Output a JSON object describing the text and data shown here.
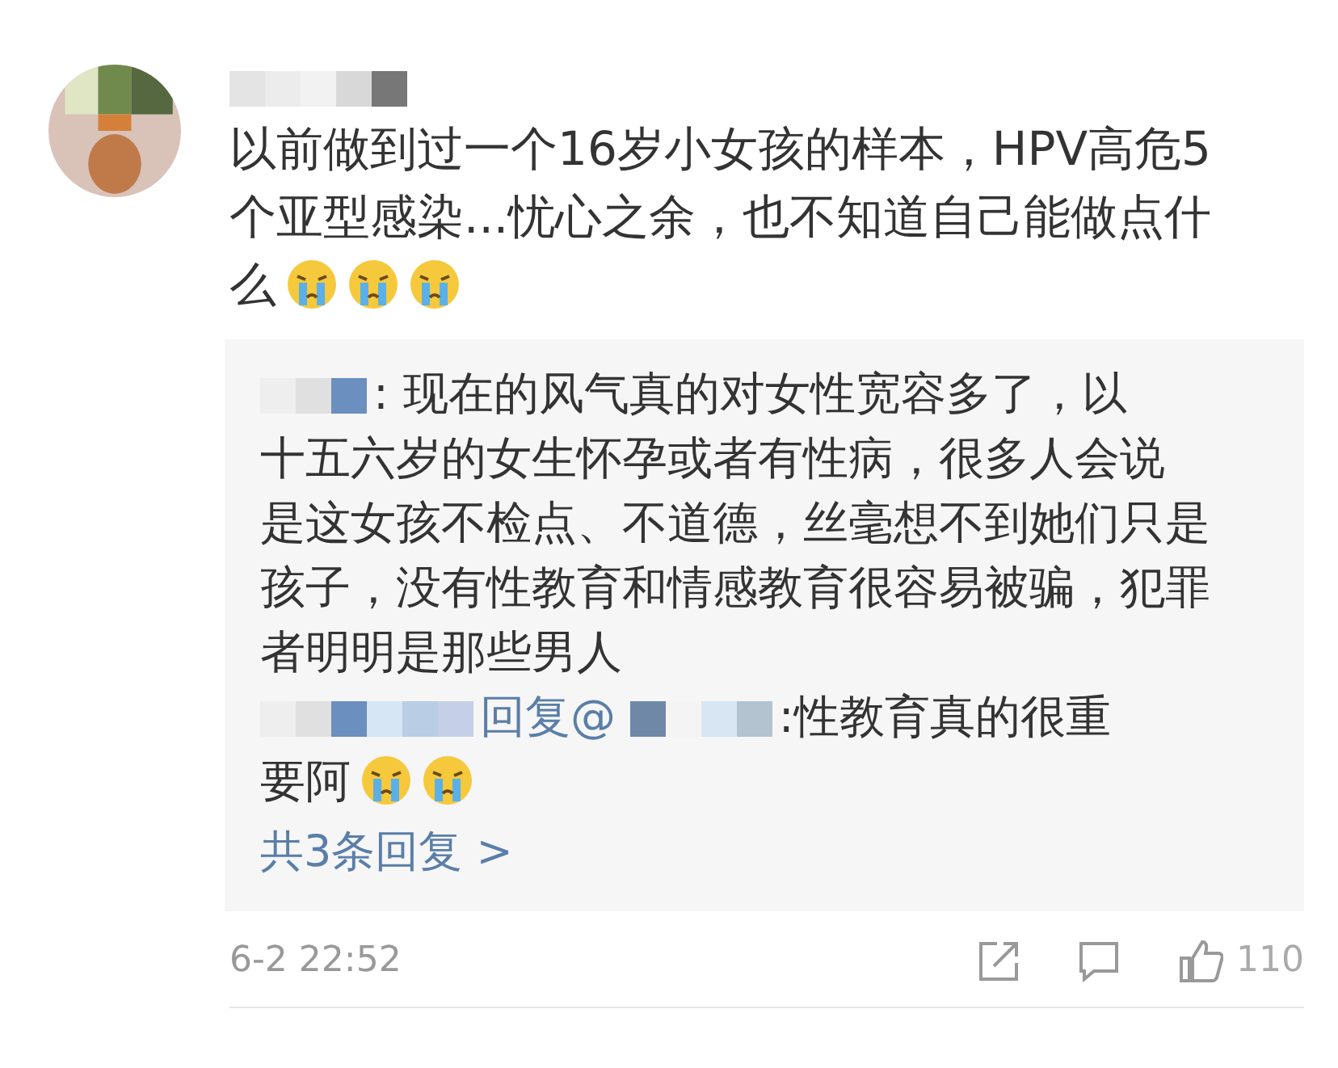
{
  "comment": {
    "lines": [
      "以前做到过一个16岁小女孩的样本，HPV高危5",
      "个亚型感染...忧心之余，也不知道自己能做点什",
      "么"
    ],
    "emojis": [
      {
        "kind": "crying"
      },
      {
        "kind": "crying"
      },
      {
        "kind": "crying"
      }
    ]
  },
  "replies": [
    {
      "lines": [
        ": 现在的风气真的对女性宽容多了，以",
        "十五六岁的女生怀孕或者有性病，很多人会说",
        "是这女孩不检点、不道德，丝毫想不到她们只是",
        "孩子，没有性教育和情感教育很容易被骗，犯罪",
        "者明明是那些男人"
      ]
    },
    {
      "lines": [
        ":性教育真的很重",
        "要阿"
      ],
      "reply_word": "回复@",
      "emojis": [
        {
          "kind": "crying"
        },
        {
          "kind": "crying"
        }
      ]
    }
  ],
  "more_replies": "共3条回复 >",
  "footer": {
    "time": "6-2 22:52",
    "likes": "110"
  }
}
